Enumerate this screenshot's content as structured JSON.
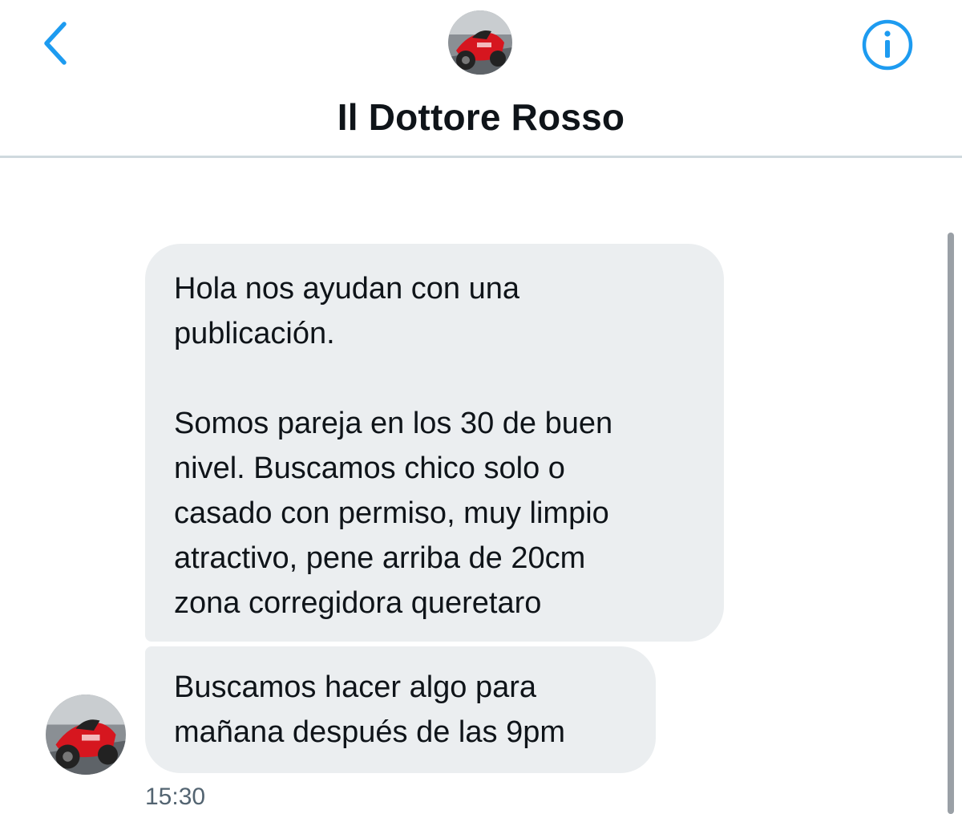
{
  "header": {
    "title": "Il Dottore Rosso",
    "back_icon": "chevron-left-icon",
    "info_icon": "info-circle-icon",
    "accent_color": "#1d9bf0"
  },
  "conversation": {
    "messages": [
      {
        "lines": [
          "Hola nos ayudan con una",
          "publicación.",
          "",
          "Somos pareja en los 30 de buen",
          "nivel. Buscamos chico solo o",
          "casado con permiso, muy limpio",
          "atractivo, pene arriba de 20cm",
          "zona corregidora queretaro"
        ]
      },
      {
        "lines": [
          "Buscamos hacer algo para",
          "mañana después de las 9pm"
        ]
      }
    ],
    "timestamp": "15:30"
  }
}
